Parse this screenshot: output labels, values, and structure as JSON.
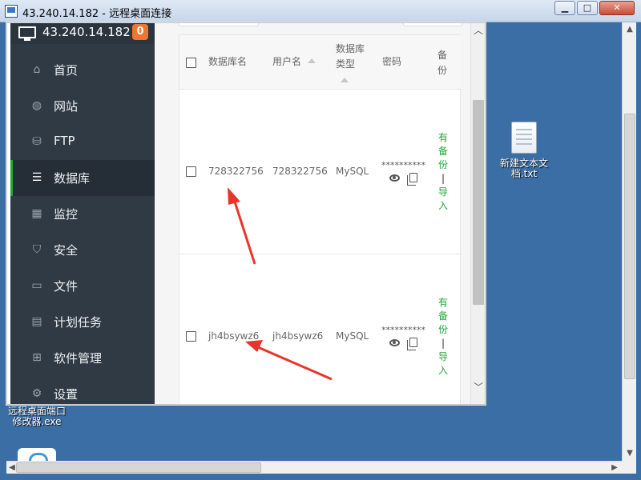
{
  "window": {
    "title": "43.240.14.182 - 远程桌面连接",
    "min_label": "▁",
    "max_label": "□",
    "close_label": "✕"
  },
  "sidebar": {
    "server_ip": "43.240.14.182",
    "badge": "0",
    "items": [
      {
        "label": "首页",
        "icon": "home-icon"
      },
      {
        "label": "网站",
        "icon": "globe-icon"
      },
      {
        "label": "FTP",
        "icon": "ftp-icon"
      },
      {
        "label": "数据库",
        "icon": "database-icon",
        "active": true
      },
      {
        "label": "监控",
        "icon": "monitor-chart-icon"
      },
      {
        "label": "安全",
        "icon": "shield-icon"
      },
      {
        "label": "文件",
        "icon": "folder-icon"
      },
      {
        "label": "计划任务",
        "icon": "calendar-icon"
      },
      {
        "label": "软件管理",
        "icon": "grid-icon"
      },
      {
        "label": "设置",
        "icon": "gear-icon"
      }
    ]
  },
  "table": {
    "headers": {
      "db_name": "数据库名",
      "username": "用户名",
      "db_type_1": "数据库",
      "db_type_2": "类型",
      "password": "密码",
      "backup_1": "备",
      "backup_2": "份"
    },
    "rows": [
      {
        "db_name": "728322756",
        "username": "728322756",
        "type": "MySQL",
        "password": "**********",
        "backup_links": [
          "有",
          "备",
          "份",
          "|",
          "导",
          "入"
        ]
      },
      {
        "db_name": "jh4bsywz6",
        "username": "jh4bsywz6",
        "type": "MySQL",
        "password": "**********",
        "backup_links": [
          "有",
          "备",
          "份",
          "|",
          "导",
          "入"
        ]
      }
    ]
  },
  "desktop": {
    "file_icon_label_1": "新建文本文",
    "file_icon_label_2": "档.txt",
    "exe_label_1": "远程桌面端口",
    "exe_label_2": "修改器.exe"
  },
  "colors": {
    "sidebar_bg": "#2f3a45",
    "accent_green": "#20a53a",
    "badge_orange": "#f0762f",
    "desktop_blue": "#3a6ea5",
    "annotation_red": "#e8352a"
  }
}
